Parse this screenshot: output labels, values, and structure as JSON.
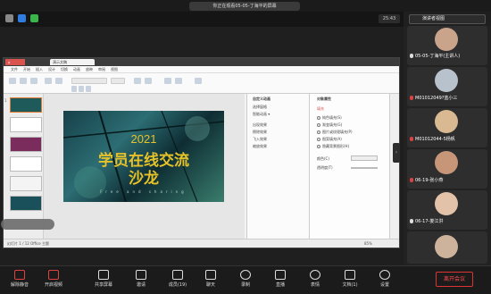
{
  "meeting": {
    "share_banner": "你正在观看05-05-丁海平的屏幕",
    "clock": "25:43",
    "view_label": "演讲者视图"
  },
  "editor": {
    "tab_label": "演示文稿",
    "menu_items": [
      "文件",
      "开始",
      "插入",
      "设计",
      "切换",
      "动画",
      "放映",
      "审阅",
      "视图"
    ],
    "slide": {
      "year": "2021",
      "title_line1": "学员在线交流",
      "title_line2": "沙龙",
      "footer": "Free and sharing"
    },
    "anim_panel": {
      "heading": "自定义动画",
      "rows": [
        "选择窗格",
        "智能动画 ▾",
        "出现效果",
        "擦除效果",
        "飞入效果",
        "缩放效果"
      ]
    },
    "prop_panel": {
      "heading": "对象属性",
      "rows": [
        "填充",
        "纯色填充(S)",
        "渐变填充(G)",
        "图片或纹理填充(P)",
        "图案填充(A)",
        "隐藏背景图形(H)",
        "颜色(C)",
        "透明度(T)"
      ]
    },
    "status_text": "幻灯片 1 / 12  Office 主题",
    "zoom": "85%"
  },
  "participants": [
    {
      "name": "05-05-丁海平(主讲人)",
      "mic_off": false,
      "avatar_color": "#c9a48a"
    },
    {
      "name": "M01012049?蓝小三",
      "mic_off": true,
      "avatar_color": "#b7c2cc"
    },
    {
      "name": "M01012044-5杨帆",
      "mic_off": true,
      "avatar_color": "#d9b991"
    },
    {
      "name": "06-19-张小燕",
      "mic_off": true,
      "avatar_color": "#c79679"
    },
    {
      "name": "06-17-娄江洪",
      "mic_off": false,
      "avatar_color": "#e2c3a9"
    },
    {
      "name": "",
      "mic_off": false,
      "avatar_color": "#cdb39c"
    }
  ],
  "toolbar": [
    {
      "label": "解除静音",
      "icon": "mic-icon",
      "color": "#e04141"
    },
    {
      "label": "开启视频",
      "icon": "camera-icon",
      "color": "#e04141"
    },
    {
      "label": "共享屏幕",
      "icon": "share-screen-icon",
      "color": "#dddddd"
    },
    {
      "label": "邀请",
      "icon": "invite-icon",
      "color": "#dddddd"
    },
    {
      "label": "成员(19)",
      "icon": "members-icon",
      "color": "#dddddd"
    },
    {
      "label": "聊天",
      "icon": "chat-icon",
      "color": "#dddddd"
    },
    {
      "label": "录制",
      "icon": "record-icon",
      "color": "#dddddd"
    },
    {
      "label": "直播",
      "icon": "live-icon",
      "color": "#dddddd"
    },
    {
      "label": "表情",
      "icon": "emoji-icon",
      "color": "#dddddd"
    },
    {
      "label": "文档(1)",
      "icon": "docs-icon",
      "color": "#dddddd"
    },
    {
      "label": "设置",
      "icon": "settings-icon",
      "color": "#dddddd"
    }
  ],
  "leave_label": "离开会议"
}
